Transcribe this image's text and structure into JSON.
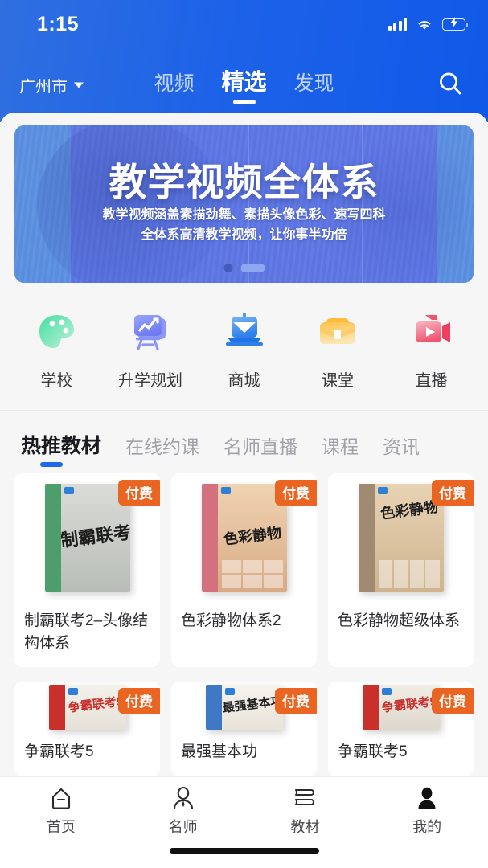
{
  "status_bar": {
    "time": "1:15",
    "signal_icon": "signal-bars-icon",
    "wifi_icon": "wifi-icon",
    "battery_icon": "battery-charging-icon",
    "battery_level_pct": 62
  },
  "header": {
    "city": "广州市",
    "city_caret_icon": "chevron-down-icon",
    "search_icon": "search-icon",
    "tabs": [
      {
        "label": "视频",
        "active": false
      },
      {
        "label": "精选",
        "active": true
      },
      {
        "label": "发现",
        "active": false
      }
    ]
  },
  "banner": {
    "title": "教学视频全体系",
    "subtitle_line1": "教学视频涵盖素描劲舞、素描头像色彩、速写四科",
    "subtitle_line2": "全体系高清教学视频，让你事半功倍",
    "dots_total": 2,
    "dots_active_index": 1,
    "accent_color": "#5fe3dc",
    "overlay_color": "#5c74e2"
  },
  "quick_links": [
    {
      "label": "学校",
      "icon": "palette-icon",
      "color": "#4fd8a8"
    },
    {
      "label": "升学规划",
      "icon": "easel-chart-icon",
      "color": "#7b86f5"
    },
    {
      "label": "商城",
      "icon": "shop-laptop-icon",
      "color": "#2f7fe8"
    },
    {
      "label": "课堂",
      "icon": "briefcase-icon",
      "color": "#f6b93b"
    },
    {
      "label": "直播",
      "icon": "video-camera-icon",
      "color": "#f2546d"
    }
  ],
  "section_tabs": [
    {
      "label": "热推教材",
      "active": true
    },
    {
      "label": "在线约课",
      "active": false
    },
    {
      "label": "名师直播",
      "active": false
    },
    {
      "label": "课程",
      "active": false
    },
    {
      "label": "资讯",
      "active": false
    }
  ],
  "products": {
    "badge_label": "付费",
    "badge_color": "#ea6522",
    "row1": [
      {
        "title": "制霸联考2–头像结构体系",
        "cover_text": "制霸联考",
        "spine_color": "#4e9e6c",
        "face_color": "#cfd4cf"
      },
      {
        "title": "色彩静物体系2",
        "cover_text": "色彩静物",
        "spine_color": "#d4717f",
        "face_color": "#e8c9a8"
      },
      {
        "title": "色彩静物超级体系",
        "cover_text": "色彩静物",
        "spine_color": "#a08a72",
        "face_color": "#e3cdae"
      }
    ],
    "row2": [
      {
        "title": "争霸联考5",
        "cover_text": "争霸联考5",
        "spine_color": "#c9302c",
        "face_color": "#f0ece6"
      },
      {
        "title": "最强基本功",
        "cover_text": "最强基本功",
        "spine_color": "#3f78c4",
        "face_color": "#f2efe9"
      },
      {
        "title": "争霸联考5",
        "cover_text": "争霸联考5",
        "spine_color": "#c9302c",
        "face_color": "#efebe4"
      }
    ]
  },
  "bottom_nav": [
    {
      "label": "首页",
      "icon": "home-icon",
      "active": false
    },
    {
      "label": "名师",
      "icon": "teacher-icon",
      "active": false
    },
    {
      "label": "教材",
      "icon": "books-icon",
      "active": false
    },
    {
      "label": "我的",
      "icon": "profile-icon",
      "active": true
    }
  ]
}
